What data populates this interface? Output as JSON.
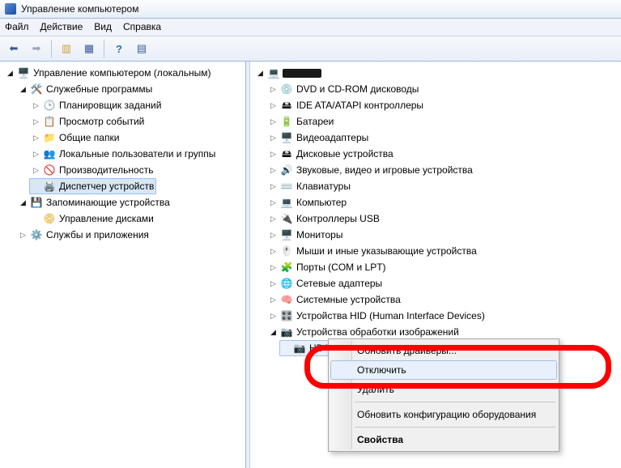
{
  "titlebar": {
    "title": "Управление компьютером"
  },
  "menu": {
    "file": "Файл",
    "action": "Действие",
    "view": "Вид",
    "help": "Справка"
  },
  "leftTree": {
    "root": "Управление компьютером (локальным)",
    "sys": {
      "label": "Служебные программы",
      "items": {
        "scheduler": "Планировщик заданий",
        "eventviewer": "Просмотр событий",
        "sharedfolders": "Общие папки",
        "usersgroups": "Локальные пользователи и группы",
        "performance": "Производительность",
        "devmgr": "Диспетчер устройств"
      }
    },
    "storage": {
      "label": "Запоминающие устройства",
      "diskmgmt": "Управление дисками"
    },
    "services": "Службы и приложения"
  },
  "rightTree": {
    "categories": {
      "dvd": "DVD и CD-ROM дисководы",
      "ide": "IDE ATA/ATAPI контроллеры",
      "battery": "Батареи",
      "video": "Видеоадаптеры",
      "disk": "Дисковые устройства",
      "sound": "Звуковые, видео и игровые устройства",
      "keyboard": "Клавиатуры",
      "computer": "Компьютер",
      "usb": "Контроллеры USB",
      "monitor": "Мониторы",
      "mouse": "Мыши и иные указывающие устройства",
      "ports": "Порты (COM и LPT)",
      "net": "Сетевые адаптеры",
      "sysdev": "Системные устройства",
      "hid": "Устройства HID (Human Interface Devices)",
      "imaging": "Устройства обработки изображений",
      "webcam": "HD WebCam"
    }
  },
  "contextMenu": {
    "updateDrivers": "Обновить драйверы...",
    "disable": "Отключить",
    "delete": "Удалить",
    "scanHardware": "Обновить конфигурацию оборудования",
    "properties": "Свойства"
  }
}
